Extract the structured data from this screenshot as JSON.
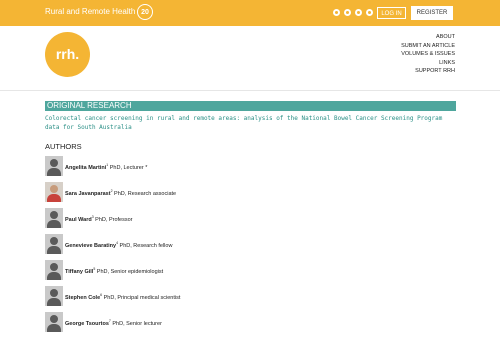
{
  "topbar": {
    "brand": "Rural and Remote Health",
    "badge": "20",
    "social_icons": [
      "facebook-icon",
      "twitter-icon",
      "linkedin-icon",
      "rss-icon"
    ],
    "login_label": "LOG IN",
    "register_label": "REGISTER",
    "color": "#f4b534"
  },
  "header": {
    "logo_text": "rrh.",
    "nav": [
      "ABOUT",
      "SUBMIT AN ARTICLE",
      "VOLUMES & ISSUES",
      "LINKS",
      "SUPPORT RRH"
    ]
  },
  "article": {
    "section": "ORIGINAL RESEARCH",
    "section_color": "#4ea69d",
    "title": "Colorectal cancer screening in rural and remote areas: analysis of the National Bowel Cancer Screening Program data for South Australia"
  },
  "authors_heading": "AUTHORS",
  "authors": [
    {
      "name": "Angelita Martini",
      "sup": "1",
      "role": " PhD, Lecturer *",
      "photo": false
    },
    {
      "name": "Sara Javanparast",
      "sup": "2",
      "role": " PhD, Research associate",
      "photo": true
    },
    {
      "name": "Paul Ward",
      "sup": "3",
      "role": " PhD, Professor",
      "photo": false
    },
    {
      "name": "Genevieve Baratiny",
      "sup": "4",
      "role": " PhD, Research fellow",
      "photo": false
    },
    {
      "name": "Tiffany Gill",
      "sup": "5",
      "role": " PhD, Senior epidemiologist",
      "photo": false
    },
    {
      "name": "Stephen Cole",
      "sup": "6",
      "role": " PhD, Principal medical scientist",
      "photo": false
    },
    {
      "name": "George Tsourtos",
      "sup": "7",
      "role": " PhD, Senior lecturer",
      "photo": false
    }
  ]
}
